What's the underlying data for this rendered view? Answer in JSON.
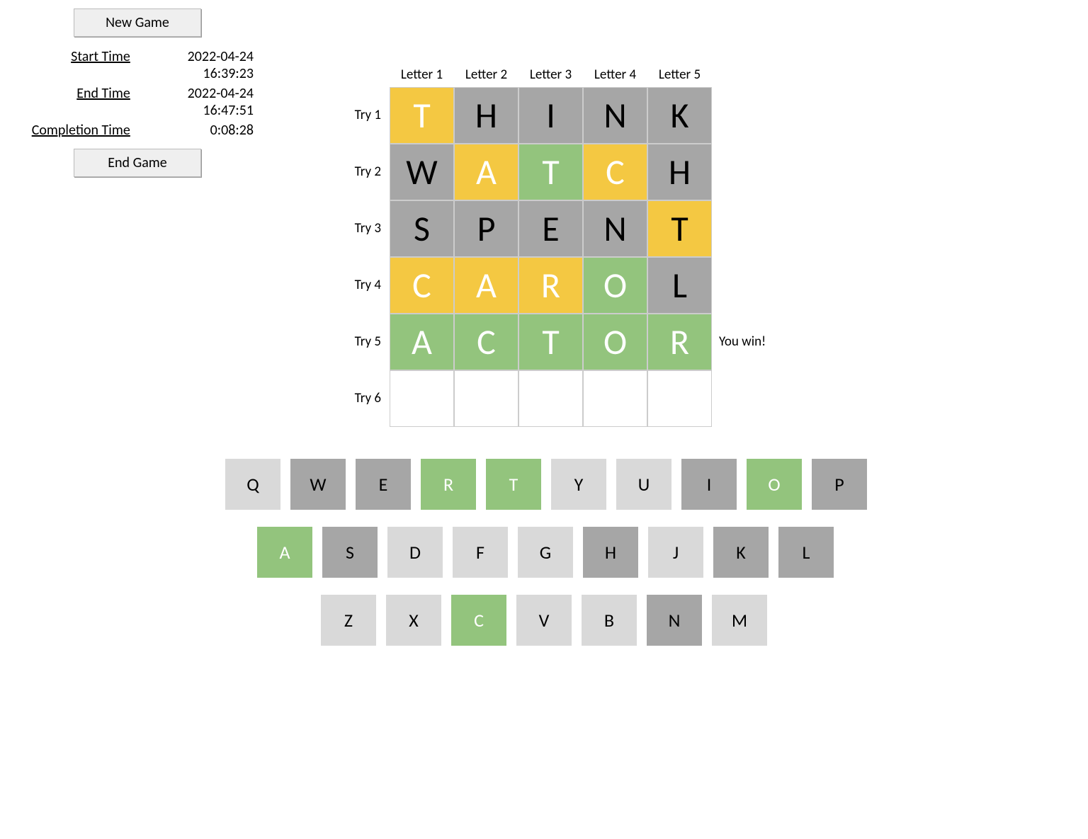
{
  "info": {
    "new_game_label": "New Game",
    "end_game_label": "End Game",
    "start_time_label": "Start Time",
    "end_time_label": "End Time",
    "completion_time_label": "Completion Time",
    "start_time": "2022-04-24 16:39:23",
    "end_time": "2022-04-24 16:47:51",
    "completion_time": "0:08:28"
  },
  "board": {
    "col_headers": [
      "Letter 1",
      "Letter 2",
      "Letter 3",
      "Letter 4",
      "Letter 5"
    ],
    "row_labels": [
      "Try 1",
      "Try 2",
      "Try 3",
      "Try 4",
      "Try 5",
      "Try 6"
    ],
    "guesses": [
      {
        "letters": [
          "T",
          "H",
          "I",
          "N",
          "K"
        ],
        "states": [
          "present",
          "absent",
          "absent",
          "absent",
          "absent"
        ],
        "message": ""
      },
      {
        "letters": [
          "W",
          "A",
          "T",
          "C",
          "H"
        ],
        "states": [
          "absent",
          "present",
          "correct",
          "present",
          "absent"
        ],
        "message": ""
      },
      {
        "letters": [
          "S",
          "P",
          "E",
          "N",
          "T"
        ],
        "states": [
          "absent",
          "absent",
          "absent",
          "absent",
          "present-dark"
        ],
        "message": ""
      },
      {
        "letters": [
          "C",
          "A",
          "R",
          "O",
          "L"
        ],
        "states": [
          "present",
          "present",
          "present",
          "correct",
          "absent"
        ],
        "message": ""
      },
      {
        "letters": [
          "A",
          "C",
          "T",
          "O",
          "R"
        ],
        "states": [
          "correct",
          "correct",
          "correct",
          "correct",
          "correct"
        ],
        "message": "You win!"
      },
      {
        "letters": [
          "",
          "",
          "",
          "",
          ""
        ],
        "states": [
          "empty",
          "empty",
          "empty",
          "empty",
          "empty"
        ],
        "message": ""
      }
    ]
  },
  "keyboard": {
    "rows": [
      [
        {
          "k": "Q",
          "s": "unused"
        },
        {
          "k": "W",
          "s": "absent"
        },
        {
          "k": "E",
          "s": "absent"
        },
        {
          "k": "R",
          "s": "correct"
        },
        {
          "k": "T",
          "s": "correct"
        },
        {
          "k": "Y",
          "s": "unused"
        },
        {
          "k": "U",
          "s": "unused"
        },
        {
          "k": "I",
          "s": "absent"
        },
        {
          "k": "O",
          "s": "correct"
        },
        {
          "k": "P",
          "s": "absent"
        }
      ],
      [
        {
          "k": "A",
          "s": "correct"
        },
        {
          "k": "S",
          "s": "absent"
        },
        {
          "k": "D",
          "s": "unused"
        },
        {
          "k": "F",
          "s": "unused"
        },
        {
          "k": "G",
          "s": "unused"
        },
        {
          "k": "H",
          "s": "absent"
        },
        {
          "k": "J",
          "s": "unused"
        },
        {
          "k": "K",
          "s": "absent"
        },
        {
          "k": "L",
          "s": "absent"
        }
      ],
      [
        {
          "k": "Z",
          "s": "unused"
        },
        {
          "k": "X",
          "s": "unused"
        },
        {
          "k": "C",
          "s": "correct"
        },
        {
          "k": "V",
          "s": "unused"
        },
        {
          "k": "B",
          "s": "unused"
        },
        {
          "k": "N",
          "s": "absent"
        },
        {
          "k": "M",
          "s": "unused"
        }
      ]
    ]
  },
  "colors": {
    "absent": "#a6a6a6",
    "present": "#f4c842",
    "correct": "#93c47d",
    "unused": "#d9d9d9"
  }
}
